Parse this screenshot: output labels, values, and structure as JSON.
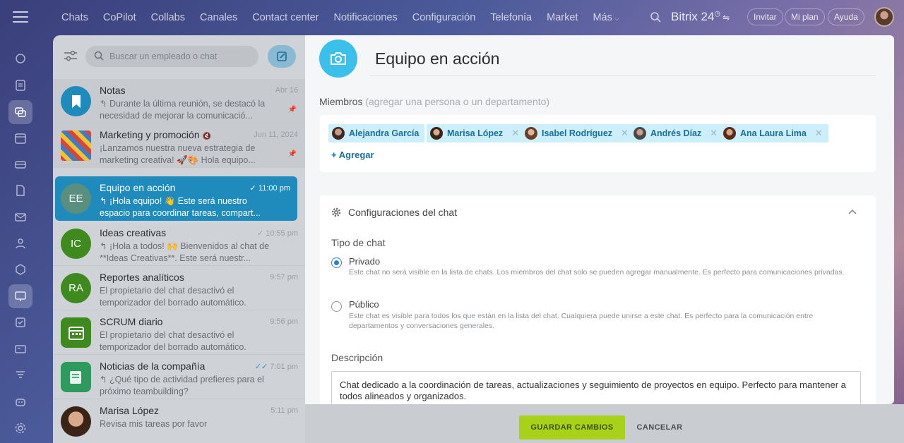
{
  "topbar": {
    "menu": [
      "Chats",
      "CoPilot",
      "Collabs",
      "Canales",
      "Contact center",
      "Notificaciones",
      "Configuración",
      "Telefonía",
      "Market",
      "Más"
    ],
    "brand": "Bitrix 24",
    "invite": "Invitar",
    "plan": "Mi plan",
    "help": "Ayuda"
  },
  "rail": {
    "icons": [
      "chat-bubble-icon",
      "feed-icon",
      "messenger-icon",
      "calendar-icon",
      "drive-icon",
      "document-icon",
      "mail-icon",
      "contacts-icon",
      "hexagon-icon",
      "board-icon",
      "tasks-icon",
      "crm-icon",
      "filter-icon",
      "robot-icon",
      "settings-icon"
    ]
  },
  "chatlist": {
    "search_placeholder": "Buscar un empleado o chat",
    "items": [
      {
        "name": "Notas",
        "time": "Abr 16",
        "preview": "↰ Durante la última reunión, se destacó la necesidad de mejorar la comunicació...",
        "avatar_text": "",
        "color": "#1f8bbd"
      },
      {
        "name": "Marketing y promoción",
        "time": "Jun 11, 2024",
        "preview": "¡Lanzamos nuestra nueva estrategia de marketing creativa! 🚀🎨 Hola equipo...",
        "avatar_text": "",
        "color": "#c0392b"
      },
      {
        "name": "Equipo en acción",
        "time": "11:00 pm",
        "preview": "↰ ¡Hola equipo! 👋 Este será nuestro espacio para coordinar tareas, compart...",
        "avatar_text": "EE",
        "color": "#5a8e7e"
      },
      {
        "name": "Ideas creativas",
        "time": "10:55 pm",
        "preview": "↰ ¡Hola a todos! 🙌 Bienvenidos al chat de **Ideas Creativas**. Este será nuestr...",
        "avatar_text": "IC",
        "color": "#3e8a1e"
      },
      {
        "name": "Reportes analíticos",
        "time": "9:57 pm",
        "preview": "El propietario del chat desactivó el temporizador del borrado automático.",
        "avatar_text": "RA",
        "color": "#3e8a1e"
      },
      {
        "name": "SCRUM diario",
        "time": "9:56 pm",
        "preview": "El propietario del chat desactivó el temporizador del borrado automático.",
        "avatar_text": "",
        "color": "#3e8a1e"
      },
      {
        "name": "Noticias de la compañía",
        "time": "7:01 pm",
        "preview": "↰ ¿Qué tipo de actividad prefieres para el próximo teambuilding?",
        "avatar_text": "",
        "color": "#2e9a5e"
      },
      {
        "name": "Marisa López",
        "time": "5:11 pm",
        "preview": "Revisa mis tareas por favor",
        "avatar_text": "",
        "color": "#7a5a3a"
      }
    ]
  },
  "form": {
    "title": "Equipo en acción",
    "members_label": "Miembros",
    "members_hint": "(agregar una persona o un departamento)",
    "members": [
      "Alejandra García",
      "Marisa López",
      "Isabel Rodríguez",
      "Andrés Díaz",
      "Ana Laura Lima"
    ],
    "add_label": "+ Agregar",
    "settings_title": "Configuraciones del chat",
    "type_label": "Tipo de chat",
    "private_title": "Privado",
    "private_desc": "Este chat no será visible en la lista de chats. Los miembros del chat solo se pueden agregar manualmente. Es perfecto para comunicaciones privadas.",
    "public_title": "Público",
    "public_desc": "Este chat es visible para todos los que están en la lista del chat. Cualquiera puede unirse a este chat. Es perfecto para la comunicación entre departamentos y conversaciones generales.",
    "description_label": "Descripción",
    "description_value": "Chat dedicado a la coordinación de tareas, actualizaciones y seguimiento de proyectos en equipo. Perfecto para mantener a todos alineados y organizados.",
    "save": "GUARDAR CAMBIOS",
    "cancel": "CANCELAR"
  }
}
